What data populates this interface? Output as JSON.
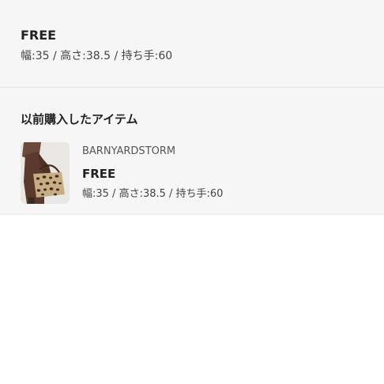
{
  "selected_size": {
    "label": "FREE",
    "dimensions": "幅:35 / 高さ:38.5 / 持ち手:60"
  },
  "previous_items": {
    "title": "以前購入したアイテム",
    "items": [
      {
        "brand": "BARNYARDSTORM",
        "size": "FREE",
        "dimensions": "幅:35 / 高さ:38.5 / 持ち手:60"
      }
    ]
  }
}
